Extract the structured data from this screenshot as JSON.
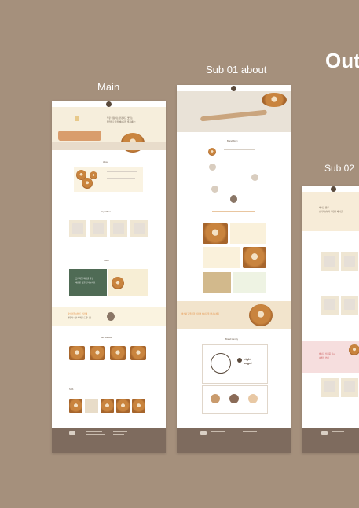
{
  "labels": {
    "main": "Main",
    "sub1": "Sub 01 about",
    "out": "Out",
    "sub2": "Sub 02"
  },
  "main": {
    "hero_lines": [
      "우유 유통비는 건강하고 맛있는",
      "천연유로 우유 베이글을 즐기세요!"
    ],
    "section_about": "About",
    "section_best": "Bagel Best",
    "section_event": "Event",
    "event_lines": [
      "프리미엄 베이글 할인",
      "새로운 맛을 만나보세요"
    ],
    "banner_lines": [
      "할인쿠폰 이벤트 기간에",
      "가입하시면 혜택을 드립니다"
    ],
    "section_review": "Best Review",
    "section_sns": "SNS"
  },
  "sub1": {
    "section_story": "Brand Story",
    "section_identity": "Brand Identity",
    "brand_name_line1": "Light",
    "brand_name_line2": "bagel",
    "banner_text": "바삭하고 쫄깃한 식감의 베이글을 만나보세요"
  },
  "sub2": {
    "hero_lines": [
      "베이글 종류",
      "오리지널부터 다양한 베이글"
    ],
    "pink_lines": [
      "베이글 신제품 출시",
      "이벤트 안내"
    ]
  },
  "colors": {
    "background": "#a5907c",
    "footer": "#7e6b5e",
    "cream": "#f6eedc",
    "green": "#4f6b55",
    "pink": "#f6dede",
    "accent": "#e48a3a"
  }
}
